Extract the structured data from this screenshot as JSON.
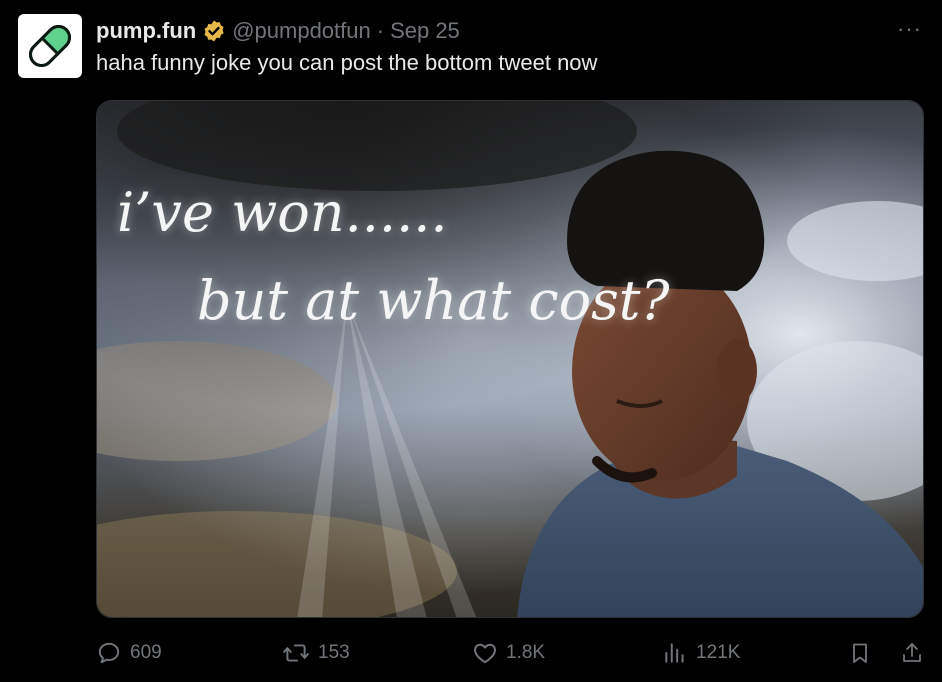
{
  "tweet": {
    "author_name": "pump.fun",
    "handle": "@pumpdotfun",
    "separator": "·",
    "date": "Sep 25",
    "more_label": "···",
    "text": "haha funny joke you can post the bottom tweet now"
  },
  "media": {
    "caption_line1": "i’ve won......",
    "caption_line2": "but at what cost?"
  },
  "actions": {
    "replies": "609",
    "reposts": "153",
    "likes": "1.8K",
    "views": "121K"
  },
  "colors": {
    "background": "#000000",
    "text": "#e7e9ea",
    "muted": "#71767b",
    "verified_badge": "#e8b84a",
    "pill_green": "#5fd38d"
  },
  "icons": [
    "pill-icon",
    "verified-badge-icon",
    "reply-icon",
    "repost-icon",
    "like-icon",
    "views-icon",
    "bookmark-icon",
    "share-icon"
  ]
}
